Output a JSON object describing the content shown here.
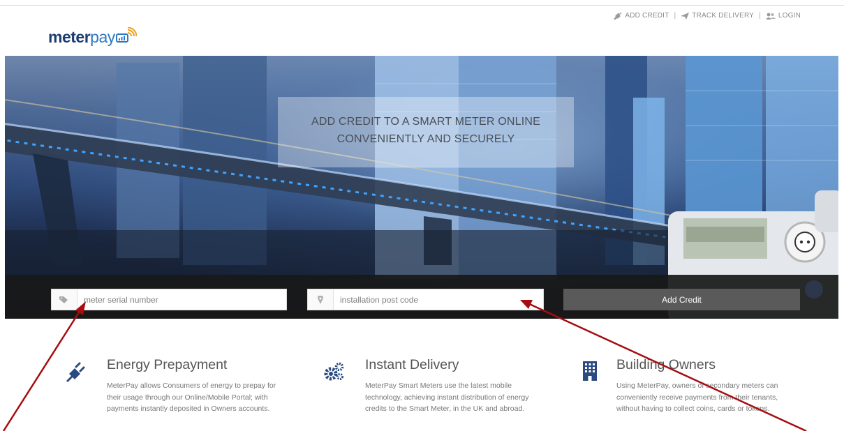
{
  "header": {
    "logo_text_1": "meter",
    "logo_text_2": "pay",
    "nav": [
      {
        "label": "ADD CREDIT",
        "icon": "plug-icon"
      },
      {
        "label": "TRACK DELIVERY",
        "icon": "send-icon"
      },
      {
        "label": "LOGIN",
        "icon": "users-icon"
      }
    ],
    "separator": "|"
  },
  "hero": {
    "headline_line1": "ADD CREDIT TO A SMART METER ONLINE",
    "headline_line2": "CONVENIENTLY AND SECURELY",
    "serial_placeholder": "meter serial number",
    "serial_icon": "tag-icon",
    "postcode_placeholder": "installation post code",
    "postcode_icon": "map-marker-icon",
    "button_label": "Add Credit"
  },
  "features": [
    {
      "icon": "plug-icon",
      "title": "Energy Prepayment",
      "text": "MeterPay allows Consumers of energy to prepay for their usage through our Online/Mobile Portal; with payments instantly deposited in Owners accounts."
    },
    {
      "icon": "gears-icon",
      "title": "Instant Delivery",
      "text": "MeterPay Smart Meters use the latest mobile technology, achieving instant distribution of energy credits to the Smart Meter, in the UK and abroad."
    },
    {
      "icon": "building-icon",
      "title": "Building Owners",
      "text": "Using MeterPay, owners of secondary meters can conveniently receive payments from their tenants, without having to collect coins, cards or tokens."
    }
  ],
  "colors": {
    "logo_dark": "#1c3c73",
    "logo_light": "#2d78c2",
    "accent_icon": "#2a4a80",
    "arrow": "#a50d12",
    "button": "#5a5a5a"
  }
}
